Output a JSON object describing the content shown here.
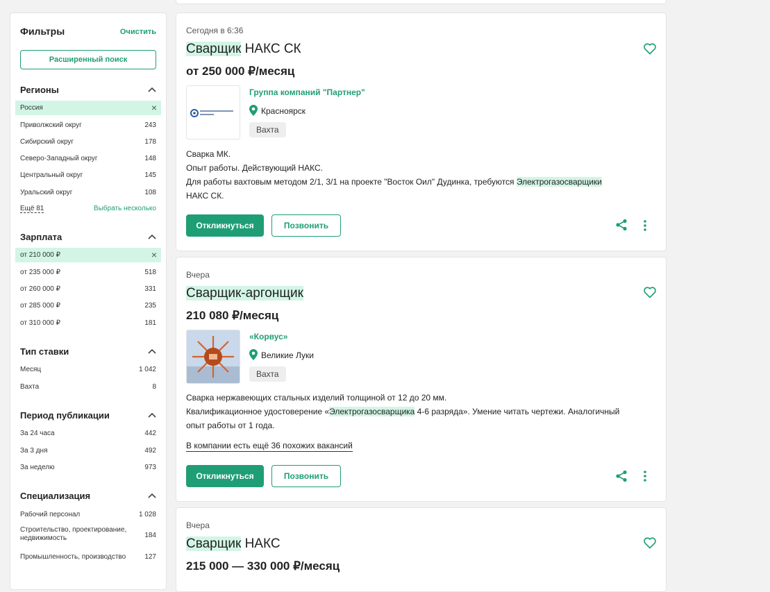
{
  "filters": {
    "header": "Фильтры",
    "clear_label": "Очистить",
    "advanced_search_label": "Расширенный поиск",
    "regions": {
      "title": "Регионы",
      "selected": "Россия",
      "items": [
        {
          "label": "Приволжский округ",
          "count": "243"
        },
        {
          "label": "Сибирский округ",
          "count": "178"
        },
        {
          "label": "Северо-Западный округ",
          "count": "148"
        },
        {
          "label": "Центральный округ",
          "count": "145"
        },
        {
          "label": "Уральский округ",
          "count": "108"
        }
      ],
      "more_label": "Ещё 81",
      "pick_label": "Выбрать несколько"
    },
    "salary": {
      "title": "Зарплата",
      "selected": "от 210 000 ₽",
      "items": [
        {
          "label": "от 235 000 ₽",
          "count": "518"
        },
        {
          "label": "от 260 000 ₽",
          "count": "331"
        },
        {
          "label": "от 285 000 ₽",
          "count": "235"
        },
        {
          "label": "от 310 000 ₽",
          "count": "181"
        }
      ]
    },
    "rate_type": {
      "title": "Тип ставки",
      "items": [
        {
          "label": "Месяц",
          "count": "1 042"
        },
        {
          "label": "Вахта",
          "count": "8"
        }
      ]
    },
    "period": {
      "title": "Период публикации",
      "items": [
        {
          "label": "За 24 часа",
          "count": "442"
        },
        {
          "label": "За 3 дня",
          "count": "492"
        },
        {
          "label": "За неделю",
          "count": "973"
        }
      ]
    },
    "specialization": {
      "title": "Специализация",
      "items": [
        {
          "label": "Рабочий персонал",
          "count": "1 028"
        },
        {
          "label": "Строительство, проектирование, недвижимость",
          "count": "184"
        },
        {
          "label": "Промышленность, производство",
          "count": "127"
        }
      ]
    }
  },
  "vacancies": [
    {
      "date": "Сегодня в 6:36",
      "title_highlight": "Сварщик",
      "title_rest": " НАКС СК",
      "salary": "от 250 000 ₽/месяц",
      "logo_text": "ГРУППА КОМПАНИЙ ПАРТНЕР",
      "company": "Группа компаний \"Партнер\"",
      "city": "Красноярск",
      "tag": "Вахта",
      "desc": {
        "line1": "Сварка МК.",
        "line2": "Опыт работы. Действующий НАКС.",
        "line3_pre": "Для работы вахтовым методом 2/1, 3/1 на проекте \"Восток Оил\" Дудинка, требуются ",
        "line3_hl": "Электрогазосварщики",
        "line4": "НАКС СК."
      },
      "apply_label": "Откликнуться",
      "call_label": "Позвонить"
    },
    {
      "date": "Вчера",
      "title_highlight": "Сварщик",
      "title_mid": "-",
      "title_highlight2": "аргонщик",
      "salary": "210 080 ₽/месяц",
      "company": "«Корвус»",
      "city": "Великие Луки",
      "tag": "Вахта",
      "desc": {
        "line1": "Сварка нержавеющих стальных изделий толщиной от 12 до 20 мм.",
        "line2_pre": "Квалификационное удостоверение «",
        "line2_hl": "Электрогазосварщика",
        "line2_post": " 4-6 разряда». Умение читать чертежи. Аналогичный",
        "line3": "опыт работы от 1 года."
      },
      "similar_label": "В компании есть ещё 36 похожих вакансий",
      "apply_label": "Откликнуться",
      "call_label": "Позвонить"
    },
    {
      "date": "Вчера",
      "title_highlight": "Сварщик",
      "title_rest": " НАКС",
      "salary": "215 000 — 330 000 ₽/месяц"
    }
  ],
  "colors": {
    "accent": "#1f9e75",
    "highlight": "#d2f5e6"
  }
}
